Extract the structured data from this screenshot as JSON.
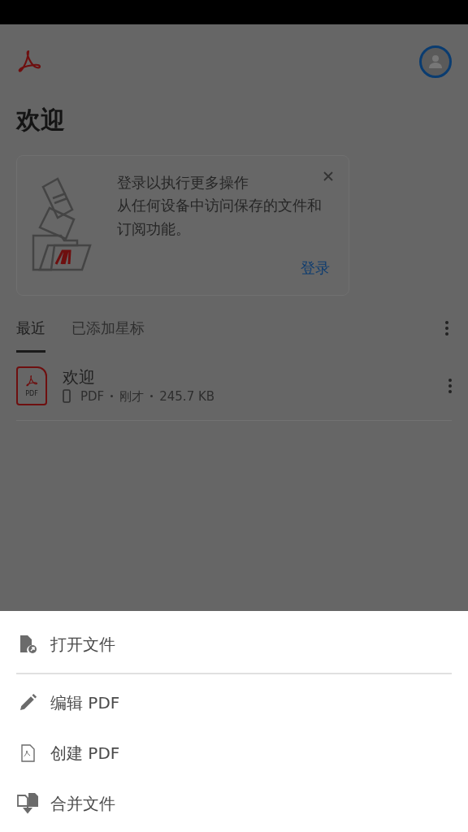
{
  "page_title": "欢迎",
  "signin_card": {
    "title": "登录以执行更多操作",
    "body": "从任何设备中访问保存的文件和订阅功能。",
    "action": "登录"
  },
  "tabs": [
    {
      "label": "最近",
      "selected": true
    },
    {
      "label": "已添加星标",
      "selected": false
    }
  ],
  "files": [
    {
      "name": "欢迎",
      "type": "PDF",
      "time": "刚才",
      "size": "245.7 KB",
      "icon_label": "PDF"
    }
  ],
  "sheet_items": [
    {
      "kind": "open",
      "label": "打开文件",
      "divider_after": true
    },
    {
      "kind": "edit",
      "label": "编辑 PDF",
      "divider_after": false
    },
    {
      "kind": "create",
      "label": "创建 PDF",
      "divider_after": false
    },
    {
      "kind": "combine",
      "label": "合并文件",
      "divider_after": false
    }
  ]
}
